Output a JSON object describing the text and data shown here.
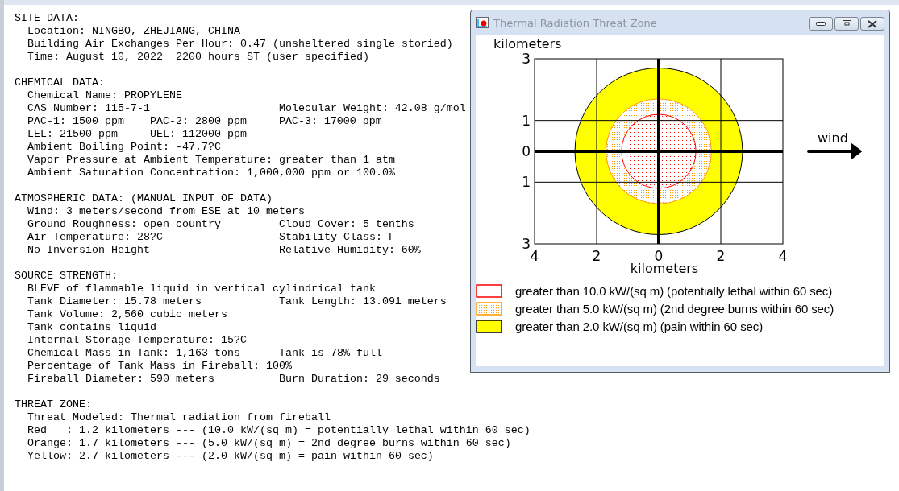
{
  "summary": {
    "sections": [
      {
        "heading": "SITE DATA:",
        "lines": [
          {
            "kind": "single",
            "cells": [
              "Location: NINGBO, ZHEJIANG, CHINA"
            ]
          },
          {
            "kind": "single",
            "cells": [
              "Building Air Exchanges Per Hour: 0.47 (unsheltered single storied)"
            ]
          },
          {
            "kind": "single",
            "cells": [
              "Time: August 10, 2022  2200 hours ST (user specified)"
            ]
          }
        ]
      },
      {
        "heading": "CHEMICAL DATA:",
        "lines": [
          {
            "kind": "single",
            "cells": [
              "Chemical Name: PROPYLENE"
            ]
          },
          {
            "kind": "wide",
            "cells": [
              "CAS Number: 115-7-1",
              "Molecular Weight: 42.08 g/mol"
            ]
          },
          {
            "kind": "triple",
            "cells": [
              "PAC-1: 1500 ppm",
              "PAC-2: 2800 ppm",
              "PAC-3: 17000 ppm"
            ]
          },
          {
            "kind": "narrow",
            "cells": [
              "LEL: 21500 ppm",
              "UEL: 112000 ppm"
            ]
          },
          {
            "kind": "single",
            "cells": [
              "Ambient Boiling Point: -47.7?C"
            ]
          },
          {
            "kind": "single",
            "cells": [
              "Vapor Pressure at Ambient Temperature: greater than 1 atm"
            ]
          },
          {
            "kind": "single",
            "cells": [
              "Ambient Saturation Concentration: 1,000,000 ppm or 100.0%"
            ]
          }
        ]
      },
      {
        "heading": "ATMOSPHERIC DATA: (MANUAL INPUT OF DATA)",
        "lines": [
          {
            "kind": "single",
            "cells": [
              "Wind: 3 meters/second from ESE at 10 meters"
            ]
          },
          {
            "kind": "wide",
            "cells": [
              "Ground Roughness: open country",
              "Cloud Cover: 5 tenths"
            ]
          },
          {
            "kind": "wide",
            "cells": [
              "Air Temperature: 28?C",
              "Stability Class: F"
            ]
          },
          {
            "kind": "wide",
            "cells": [
              "No Inversion Height",
              "Relative Humidity: 60%"
            ]
          }
        ]
      },
      {
        "heading": "SOURCE STRENGTH:",
        "lines": [
          {
            "kind": "single",
            "cells": [
              "BLEVE of flammable liquid in vertical cylindrical tank"
            ]
          },
          {
            "kind": "wide",
            "cells": [
              "Tank Diameter: 15.78 meters",
              "Tank Length: 13.091 meters"
            ]
          },
          {
            "kind": "single",
            "cells": [
              "Tank Volume: 2,560 cubic meters"
            ]
          },
          {
            "kind": "single",
            "cells": [
              "Tank contains liquid"
            ]
          },
          {
            "kind": "single",
            "cells": [
              "Internal Storage Temperature: 15?C"
            ]
          },
          {
            "kind": "wide",
            "cells": [
              "Chemical Mass in Tank: 1,163 tons",
              "Tank is 78% full"
            ]
          },
          {
            "kind": "single",
            "cells": [
              "Percentage of Tank Mass in Fireball: 100%"
            ]
          },
          {
            "kind": "wide",
            "cells": [
              "Fireball Diameter: 590 meters",
              "Burn Duration: 29 seconds"
            ]
          }
        ]
      },
      {
        "heading": "THREAT ZONE:",
        "lines": [
          {
            "kind": "single",
            "cells": [
              "Threat Modeled: Thermal radiation from fireball"
            ]
          },
          {
            "kind": "single",
            "cells": [
              "Red   : 1.2 kilometers --- (10.0 kW/(sq m) = potentially lethal within 60 sec)"
            ]
          },
          {
            "kind": "single",
            "cells": [
              "Orange: 1.7 kilometers --- (5.0 kW/(sq m) = 2nd degree burns within 60 sec)"
            ]
          },
          {
            "kind": "single",
            "cells": [
              "Yellow: 2.7 kilometers --- (2.0 kW/(sq m) = pain within 60 sec)"
            ]
          }
        ]
      }
    ]
  },
  "threat_window": {
    "title": "Thermal Radiation Threat Zone",
    "wind_label": "wind",
    "y_axis_label": "kilometers",
    "x_axis_label": "kilometers",
    "y_tick_labels": [
      "3",
      "1",
      "0",
      "1",
      "3"
    ],
    "x_tick_labels": [
      "4",
      "2",
      "0",
      "2",
      "4"
    ],
    "zones": [
      {
        "label": "greater than 10.0 kW/(sq m) (potentially lethal within 60 sec)",
        "color": "#ff0000",
        "kind": "sparse-dots"
      },
      {
        "label": "greater than 5.0 kW/(sq m) (2nd degree burns within 60 sec)",
        "color": "#ff9900",
        "kind": "dense-dots"
      },
      {
        "label": "greater than 2.0 kW/(sq m) (pain within 60 sec)",
        "color": "#ffff00",
        "kind": "solid"
      }
    ]
  }
}
